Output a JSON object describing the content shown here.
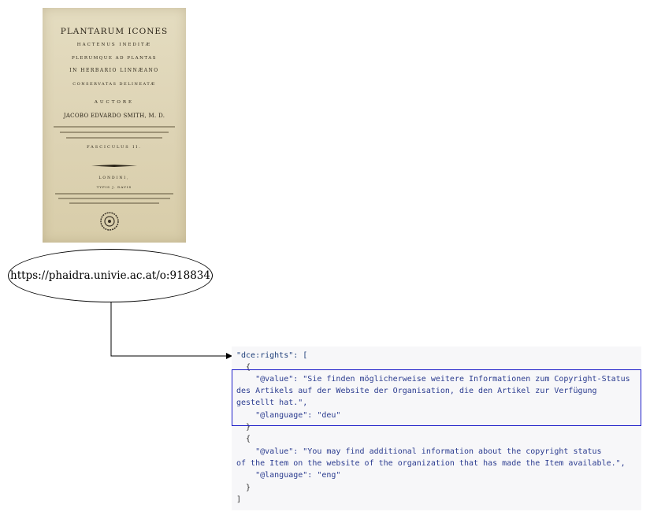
{
  "book": {
    "title": "PLANTARUM ICONES",
    "line2": "HACTENUS INEDITÆ",
    "line3": "PLERUMQUE AD PLANTAS",
    "line4": "IN HERBARIO LINNÆANO",
    "line5": "CONSERVATAS DELINEATÆ",
    "line6": "AUCTORE",
    "author": "JACOBO EDVARDO SMITH, M. D.",
    "line8": "FASCICULUS II.",
    "line9": "LONDINI,",
    "line10": "TYPIS J. DAVIS"
  },
  "node": {
    "url": "https://phaidra.univie.ac.at/o:918834"
  },
  "code": {
    "lines": [
      "\"dce:rights\": [",
      "  {",
      "    \"@value\": \"Sie finden möglicherweise weitere Informationen zum Copyright-Status",
      "des Artikels auf der Website der Organisation, die den Artikel zur Verfügung",
      "gestellt hat.\",",
      "    \"@language\": \"deu\"",
      "  }",
      "  {",
      "    \"@value\": \"You may find additional information about the copyright status",
      "of the Item on the website of the organization that has made the Item available.\",",
      "    \"@language\": \"eng\"",
      "  }",
      "]"
    ]
  }
}
